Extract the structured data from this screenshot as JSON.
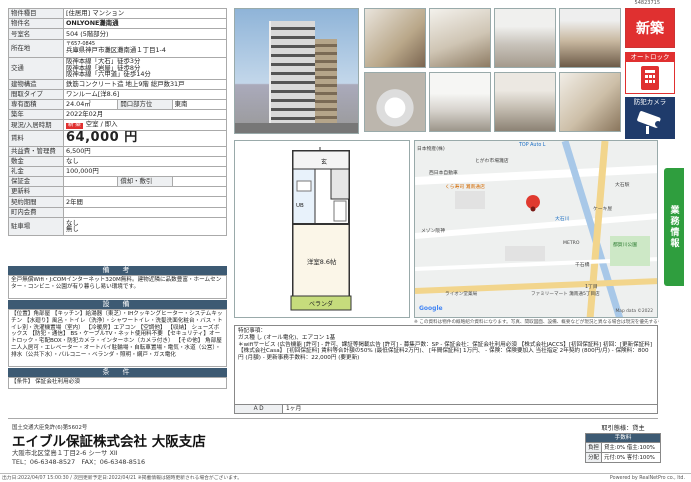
{
  "top_code": "54823715",
  "spec_rows": [
    {
      "label": "物件種目",
      "value": "[住居用] マンション"
    },
    {
      "label": "物件名",
      "value": "ONLYONE灘南通"
    },
    {
      "label": "号室名",
      "value": "504 (5階部分)"
    },
    {
      "label": "所在地",
      "value": "〒657-0845",
      "value2": "兵庫県神戸市灘区灘南通１丁目1-4"
    },
    {
      "label": "交通",
      "lines": [
        "阪神本線「大石」徒歩3分",
        "阪神本線「岩屋」徒歩8分",
        "阪神本線「六甲道」徒歩14分"
      ]
    },
    {
      "label": "建物構造",
      "value": "鉄筋コンクリート造 地上9階 総戸数31戸"
    },
    {
      "label": "間取タイプ",
      "value": "ワンルーム[洋8.6]"
    },
    {
      "label": "専有面積",
      "value": "24.04㎡",
      "mid_label": "開口部方位",
      "mid_value": "東南"
    },
    {
      "label": "築年",
      "value": "2022年02月"
    },
    {
      "label": "現況/入居時期",
      "badge": "新 築",
      "value": "空室 / 即入"
    },
    {
      "label": "賃料",
      "value": "64,000 円"
    },
    {
      "label": "共益費・管理費",
      "value": "6,500円"
    },
    {
      "label": "敷金",
      "value": "なし"
    },
    {
      "label": "礼金",
      "value": "100,000円"
    },
    {
      "label": "保証金",
      "value": "",
      "mid_label": "償却・敷引",
      "mid_value": ""
    },
    {
      "label": "更新料",
      "value": ""
    },
    {
      "label": "契約期間",
      "value": "2年間"
    },
    {
      "label": "町内会費",
      "value": ""
    },
    {
      "label": "駐車場",
      "value": "なし",
      "value2": "無し"
    }
  ],
  "sections": {
    "biko": {
      "title": "備　考",
      "text": "全戸無償Wifi・J:COMインターネット320M無料。建物近隣に品数豊富・ホームセンター・コンビニ・公園が有り暮らし易い環境です。"
    },
    "setsubi": {
      "title": "設　備",
      "text": "【位置】角部屋 【キッチン】給湯器（東芝）・IHクッキングヒーター・システムキッチン 【水廻り】風呂・トイレ（洗浄）・シャワートイレ・洗髪洗面化粧台・バス・トイレ別・洗濯機置場（室内） 【冷暖房】エアコン 【空調他】 【収納】 シューズボックス 【防犯・通信】 BS・ケーブルTV・ネット使用料不要 【セキュリティ】オートロック・宅配BOX・防犯カメラ・インターホン（カメラ付き） 【その他】 角部屋二人入居可・エレベーター・オートバイ駐輪場・自転車置場・電気・水道（公営）・排水（公共下水）・バルコニー・ベランダ・照明・網戸・ガス電化"
    },
    "joken": {
      "title": "条　件",
      "text": "【条件】 保証会社利用必須"
    }
  },
  "photos": {
    "main_alt": "建物外観",
    "thumbs": [
      "室内1",
      "室内2",
      "室内3",
      "キッチン",
      "トイレ",
      "洗面台",
      "浴室",
      "室内4"
    ]
  },
  "badges": {
    "new": "新築",
    "autolock": "オートロック",
    "camera": "防犯カメラ"
  },
  "side_tab": "業務情報",
  "floor_plan": {
    "room_label": "洋室8.6帖",
    "veranda_label": "ベランダ",
    "gen_label": "玄",
    "ub_label": "UB"
  },
  "map": {
    "labels": [
      "日本物産(株)",
      "TOP Auto L",
      "とがわ市場灘店",
      "西日本自動車",
      "くら寿司 灘南通店",
      "メゾン阪神",
      "千石橋",
      "大石川",
      "ケーキ屋",
      "都賀川公園",
      "大石駅",
      "ファミリーマート 灘南通5丁目店",
      "Google",
      "1丁目",
      "Map data ©2022",
      "METRO",
      "ライオン堂薬局"
    ],
    "google": "Google",
    "mapdata": "Map data ©2022"
  },
  "disclaimer": "※ この資料は物件の概略紹介資料になります。写真、間取図面、設備、概要などが現況と異なる場合は現況を優先するものとします。",
  "remarks": {
    "label": "特記事項：",
    "lines": [
      "ガス種 し (オール電化)、エアコン 1基",
      "＊wifiサービス (広告機能 [許可] - 許可、課証等掲載広告 [許可] - 募集戸数：SP - 保証会社：保証会社利用必須 【株式会社JACCS】[初回保証料] 初回：[更新保証料] 【株式会社Casa】 [初回保証料] 賃料等合計額の50% (最低保証料2万円)、 [年間保証料] 1万円、 - 保険：保険要加入 当社指定 2年契約 (800円/月) - 保険料：800円 (月額) - 更新事務手数料：22,000円 (要更新)"
    ]
  },
  "ad": {
    "label": "ＡＤ",
    "value": "1ヶ月"
  },
  "company": {
    "registration": "国土交通大臣免許(6)第5602号",
    "name": "エイブル保証株式会社 大阪支店",
    "address": "大阪市北区堂島１丁目2-6 シーサ XII",
    "tel": "TEL：06-6348-8527　FAX：06-6348-8516"
  },
  "deal": {
    "type": "取引態様：貸主",
    "fee_header": "手数料",
    "rows": [
      {
        "k": "負担",
        "v": "貸主:0% 借主:100%"
      },
      {
        "k": "分配",
        "v": "元付:0% 客付:100%"
      }
    ]
  },
  "footer": {
    "left": "出力日:2022/04/07 15:00:30 / 次回更新予定日:2022/04/21 ※掲載情報は随時更新される場合がございます。",
    "right": "Powered by RealNetPro co., ltd."
  }
}
